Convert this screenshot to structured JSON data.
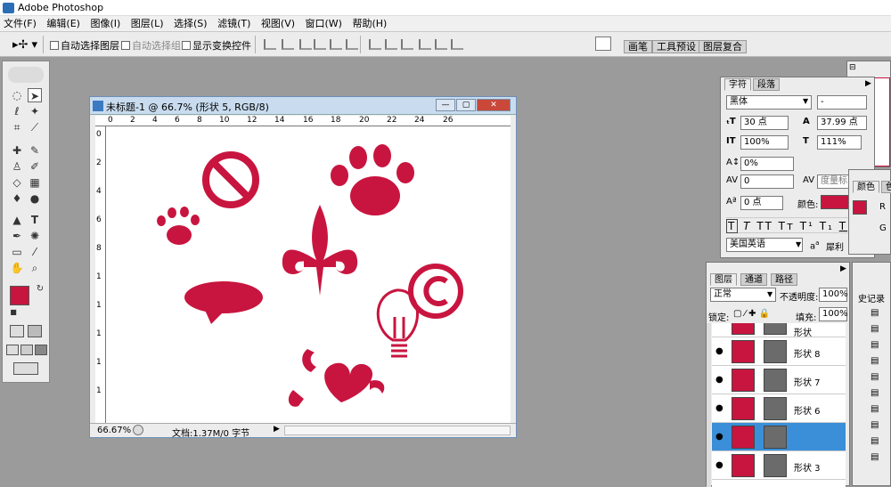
{
  "app": {
    "title": "Adobe Photoshop"
  },
  "menu": [
    "文件(F)",
    "编辑(E)",
    "图像(I)",
    "图层(L)",
    "选择(S)",
    "滤镜(T)",
    "视图(V)",
    "窗口(W)",
    "帮助(H)"
  ],
  "options": {
    "auto_select_layer": "自动选择图层",
    "auto_select_group": "自动选择组",
    "show_transform": "显示变换控件"
  },
  "well_tabs": [
    "画笔",
    "工具预设",
    "图层复合"
  ],
  "document": {
    "title": "未标题-1 @ 66.7% (形状 5, RGB/8)",
    "zoom": "66.67%",
    "doc_info": "文档:1.37M/0 字节",
    "ruler_labels": [
      "0",
      "2",
      "4",
      "6",
      "8",
      "10",
      "12",
      "14",
      "16",
      "18",
      "20",
      "22",
      "24",
      "26"
    ],
    "ruler_left_labels": [
      "0",
      "2",
      "4",
      "6",
      "8",
      "1",
      "1",
      "1",
      "1",
      "1",
      "1"
    ]
  },
  "character": {
    "tabs": [
      "字符",
      "段落"
    ],
    "font_family": "黑体",
    "font_style": "-",
    "font_size": "30 点",
    "leading": "37.99 点",
    "vscale": "100%",
    "hscale": "111%",
    "baseline": "0%",
    "tracking": "0",
    "kerning_label": "度量标",
    "shift": "0 点",
    "color_label": "颜色:",
    "language": "美国英语",
    "aa_label": "a",
    "aa_mode": "犀利",
    "color_value": "#c8153f"
  },
  "color_panel": {
    "tab": "颜色",
    "tab2": "色",
    "r": "R",
    "g": "G",
    "swatch": "#c8153f"
  },
  "layers": {
    "tabs": [
      "图层",
      "通道",
      "路径"
    ],
    "blend_mode": "正常",
    "opacity_label": "不透明度:",
    "opacity": "100%",
    "lock_label": "锁定:",
    "fill_label": "填充:",
    "fill": "100%",
    "top_partial": "形状",
    "rows": [
      {
        "name": "形状 8"
      },
      {
        "name": "形状 7"
      },
      {
        "name": "形状 6"
      },
      {
        "name": ""
      },
      {
        "name": "形状 3"
      }
    ]
  },
  "history_tab": "史记录",
  "colors": {
    "accent": "#c8153f",
    "workspace": "#9b9b9b"
  }
}
